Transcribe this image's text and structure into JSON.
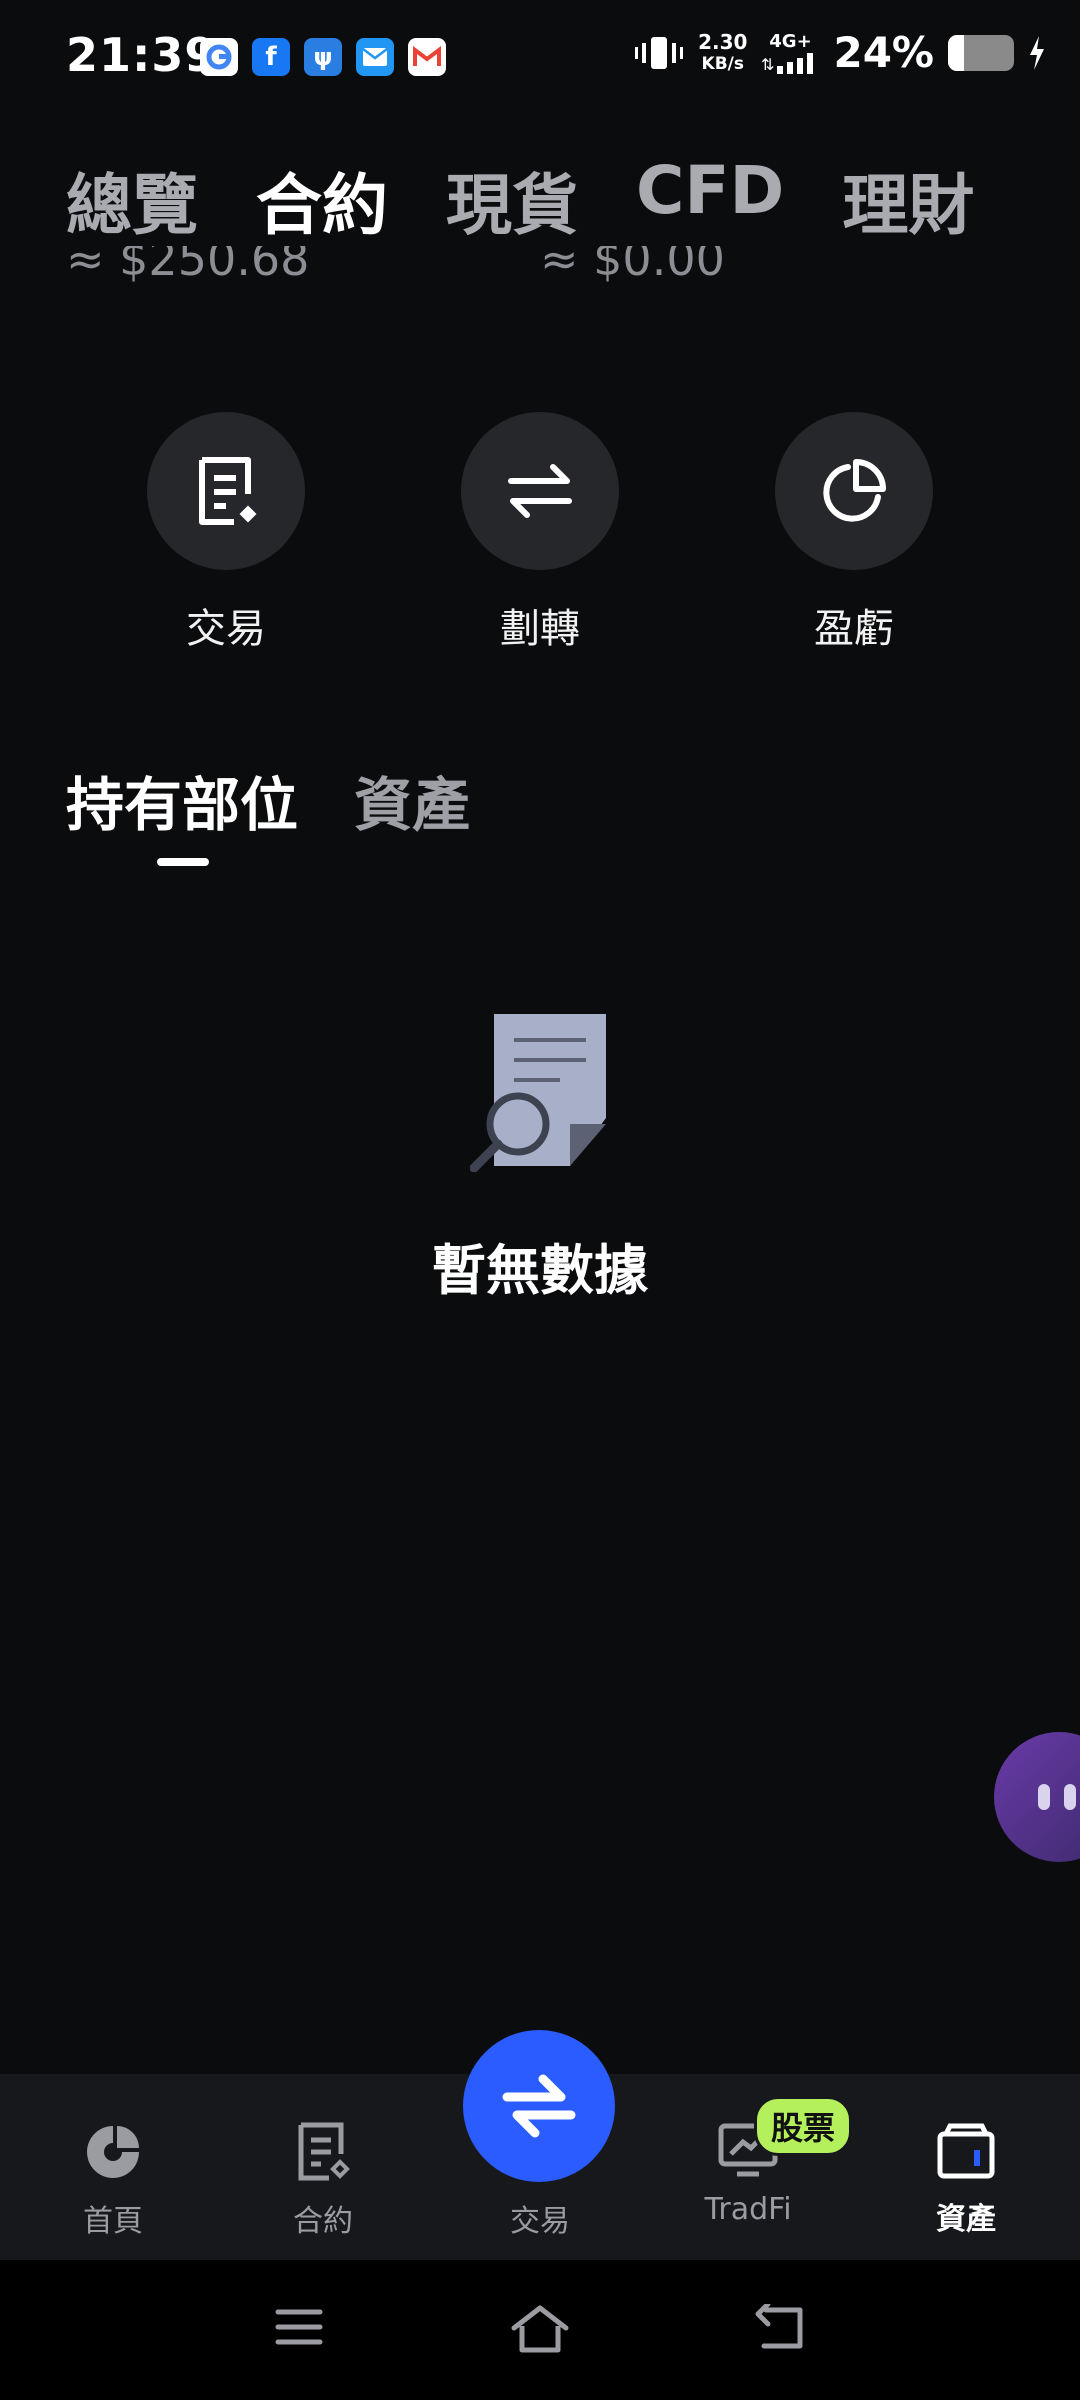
{
  "status_bar": {
    "time": "21:39",
    "network_speed_value": "2.30",
    "network_speed_unit": "KB/s",
    "network_type": "4G+",
    "battery_percent": "24%",
    "battery_level": 0.24,
    "notification_icons": [
      "google-icon",
      "facebook-icon",
      "usb-icon",
      "email-icon",
      "gmail-icon"
    ]
  },
  "top_tabs": [
    {
      "label": "總覽",
      "active": false
    },
    {
      "label": "合約",
      "active": true
    },
    {
      "label": "現貨",
      "active": false
    },
    {
      "label": "CFD",
      "active": false
    },
    {
      "label": "理財",
      "active": false
    }
  ],
  "balances": {
    "left": "≈ $250.68",
    "right": "≈ $0.00"
  },
  "actions": [
    {
      "label": "交易",
      "icon": "document-icon"
    },
    {
      "label": "劃轉",
      "icon": "transfer-arrows-icon"
    },
    {
      "label": "盈虧",
      "icon": "pie-chart-icon"
    }
  ],
  "section_tabs": [
    {
      "label": "持有部位",
      "active": true
    },
    {
      "label": "資產",
      "active": false
    }
  ],
  "empty_state": {
    "text": "暫無數據"
  },
  "bottom_nav": {
    "items": [
      {
        "label": "首頁",
        "icon": "home-logo-icon",
        "active": false
      },
      {
        "label": "合約",
        "icon": "contract-icon",
        "active": false
      },
      {
        "label": "交易",
        "icon": "swap-arrows-icon",
        "active": false
      },
      {
        "label": "TradFi",
        "icon": "tradfi-chart-icon",
        "active": false
      },
      {
        "label": "資產",
        "icon": "wallet-icon",
        "active": true
      }
    ],
    "tradfi_badge": "股票"
  },
  "colors": {
    "background": "#0b0c0e",
    "accent_blue": "#2a5cff",
    "badge_green": "#b4f05c",
    "nav_background": "#17181b"
  }
}
